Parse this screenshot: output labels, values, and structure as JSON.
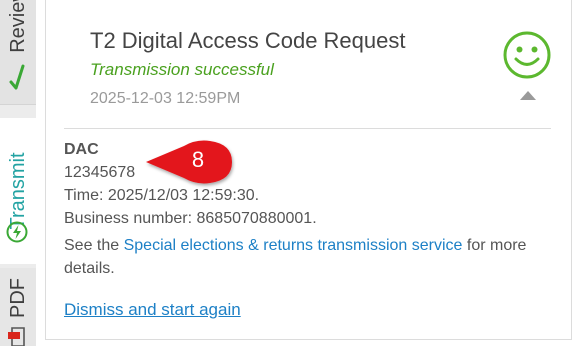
{
  "rail": {
    "tabs": [
      {
        "label": "Review"
      },
      {
        "label": "Transmit"
      },
      {
        "label": "PDF"
      }
    ]
  },
  "card": {
    "title": "T2 Digital Access Code Request",
    "status": "Transmission successful",
    "datetime": "2025-12-03 12:59PM"
  },
  "details": {
    "dac_label": "DAC",
    "dac_value": "12345678",
    "time_line": "Time: 2025/12/03 12:59:30.",
    "business_line": "Business number: 8685070880001.",
    "see_prefix": "See the ",
    "see_link": "Special elections & returns transmission service",
    "see_suffix": " for more details."
  },
  "dismiss_label": "Dismiss and start again",
  "callout": {
    "number": "8"
  },
  "colors": {
    "accent_teal": "#23a3a3",
    "success_green": "#4aa11f",
    "link_blue": "#1d80c6",
    "callout_red": "#e3161b"
  },
  "icons": [
    "check-icon",
    "lightning-icon",
    "pdf-icon",
    "smiley-icon",
    "chevron-up-icon"
  ]
}
